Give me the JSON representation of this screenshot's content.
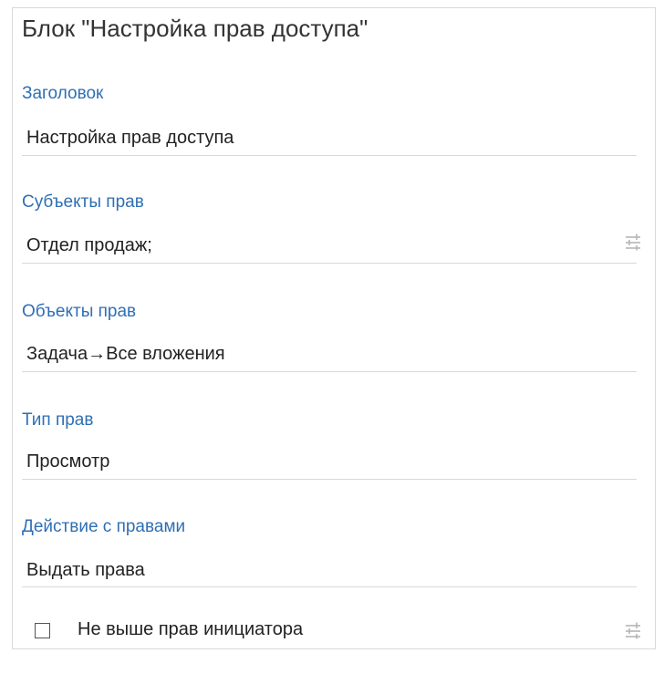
{
  "block": {
    "title": "Блок \"Настройка прав доступа\""
  },
  "fields": [
    {
      "label": "Заголовок",
      "value": "Настройка прав доступа"
    },
    {
      "label": "Субъекты прав",
      "value": "Отдел продаж;",
      "icon": "settings-sliders-icon"
    },
    {
      "label": "Объекты прав",
      "value": "Задача→Все вложения"
    },
    {
      "label": "Тип прав",
      "value": "Просмотр"
    },
    {
      "label": "Действие с правами",
      "value": "Выдать права"
    }
  ],
  "checkbox": {
    "label": "Не выше прав инициатора",
    "checked": false,
    "icon": "settings-sliders-icon"
  },
  "colors": {
    "label_blue": "#2f6fb3",
    "border_gray": "#d9d9d9",
    "icon_gray": "#b5b5b5"
  }
}
